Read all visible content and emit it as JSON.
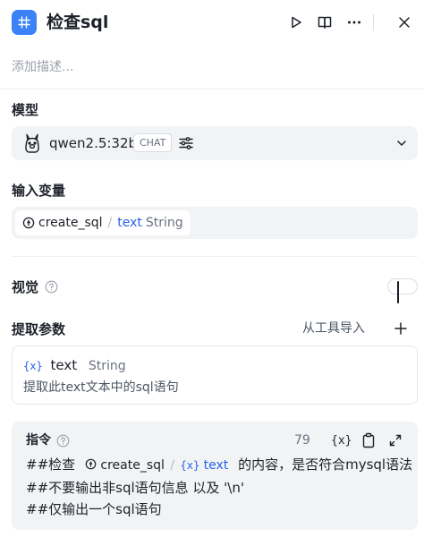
{
  "header": {
    "title": "检查sql",
    "description_placeholder": "添加描述..."
  },
  "model_section": {
    "title": "模型",
    "model_name": "qwen2.5:32b",
    "mode_badge": "CHAT"
  },
  "input_section": {
    "title": "输入变量",
    "node_name": "create_sql",
    "separator": "/",
    "var_name": "text",
    "var_type": "String"
  },
  "vision_section": {
    "title": "视觉",
    "enabled": false
  },
  "extract_section": {
    "title": "提取参数",
    "import_label": "从工具导入",
    "params": [
      {
        "icon_text": "{x}",
        "name": "text",
        "type": "String",
        "description": "提取此text文本中的sql语句"
      }
    ]
  },
  "instruction_section": {
    "title": "指令",
    "char_count": "79",
    "var_button_label": "{x}",
    "line1_prefix": "##检查",
    "line1_node": "create_sql",
    "line1_sep": "/",
    "line1_icon": "{x}",
    "line1_var": "text",
    "line1_suffix": "的内容，是否符合mysql语法",
    "line2": "##不要输出非sql语句信息 以及 '\\n'",
    "line3": "##仅输出一个sql语句"
  },
  "colors": {
    "accent": "#3b82f6",
    "link_blue": "#2563eb",
    "panel_bg": "#f2f3f5"
  }
}
